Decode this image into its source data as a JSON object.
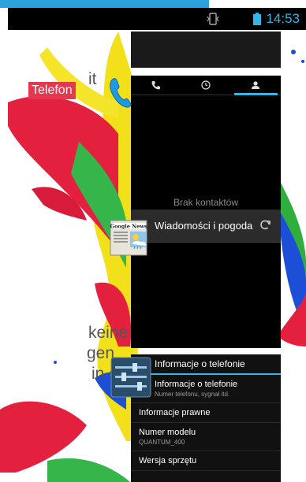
{
  "status_bar": {
    "time": "14:53"
  },
  "background_text": {
    "fragment_it": "it",
    "fragment_telefon": "Telefon",
    "line1": "keine",
    "line2": "gen",
    "line3": "in der"
  },
  "cards": {
    "phone": {
      "empty_text": "Brak kontaktów"
    },
    "news": {
      "app_name": "Wiadomości i pogoda",
      "icon_label": "Google News"
    },
    "settings": {
      "header": "Informacje o telefonie",
      "rows": [
        {
          "title": "Informacje o telefonie",
          "subtitle": "Numer telefonu, sygnał itd."
        },
        {
          "title": "Informacje prawne",
          "subtitle": ""
        },
        {
          "title": "Numer modelu",
          "subtitle": "QUANTUM_400"
        },
        {
          "title": "Wersja sprzętu",
          "subtitle": ""
        }
      ]
    }
  },
  "colors": {
    "accent": "#33b5e5"
  }
}
